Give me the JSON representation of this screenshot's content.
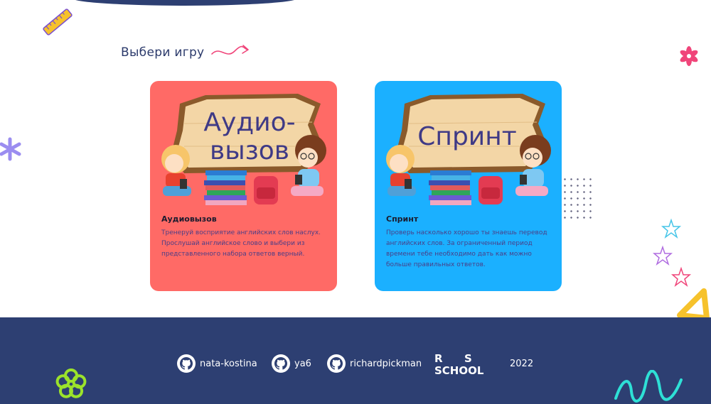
{
  "section_title": "Выбери игру",
  "cards": [
    {
      "art_text_line1": "Аудио-",
      "art_text_line2": "вызов",
      "title": "Аудиовызов",
      "description": "Тренеруй восприятие английских слов наслух. Прослушай английское слово и выбери из представленного набора ответов верный.",
      "color": "#ff6a66"
    },
    {
      "art_text_line1": "Спринт",
      "title": "Спринт",
      "description": "Проверь насколько хорошо ты знаешь перевод английских слов. За ограниченный период времени тебе необходимо дать как можно больше правильных ответов.",
      "color": "#1bb0ff"
    }
  ],
  "footer": {
    "authors": [
      {
        "name": "nata-kostina",
        "icon": "github-icon"
      },
      {
        "name": "ya6",
        "icon": "github-icon"
      },
      {
        "name": "richardpickman",
        "icon": "github-icon"
      }
    ],
    "logo_text": "RS SCHOOL",
    "year": "2022",
    "background": "#2d3f72"
  },
  "colors": {
    "accent_navy": "#2d3f72",
    "accent_pink": "#f0457a",
    "accent_yellow": "#f6c22c"
  }
}
